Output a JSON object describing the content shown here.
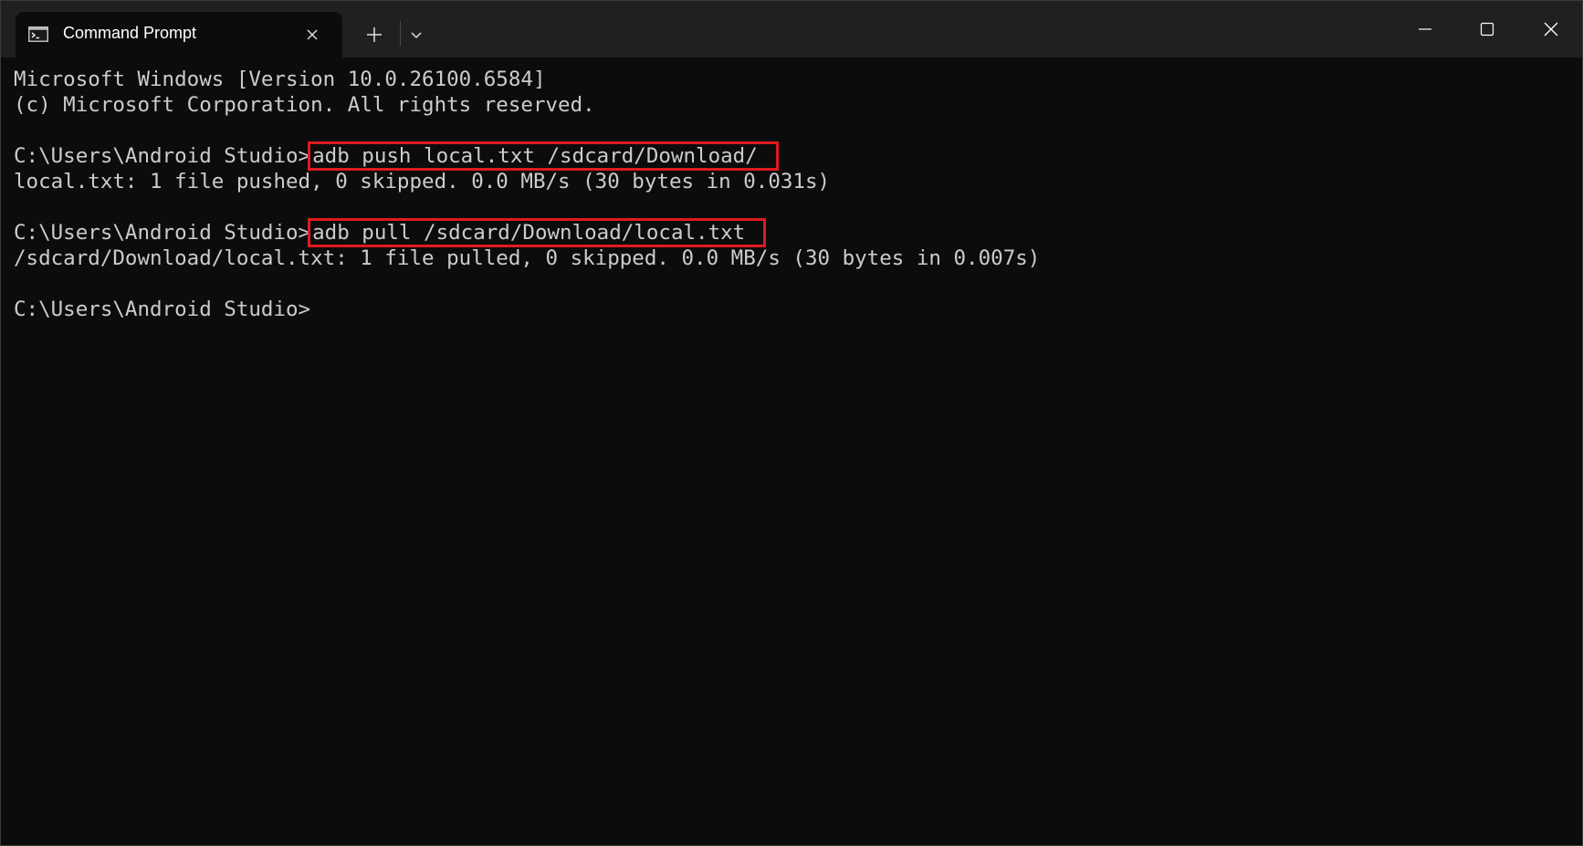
{
  "window": {
    "tab_title": "Command Prompt"
  },
  "icons": {
    "tab": "terminal-icon",
    "close_tab": "close-icon",
    "new_tab": "plus-icon",
    "dropdown": "chevron-down-icon",
    "minimize": "minimize-icon",
    "maximize": "maximize-icon",
    "close_window": "close-icon"
  },
  "colors": {
    "terminal_bg": "#0c0c0c",
    "terminal_text": "#cccccc",
    "titlebar_bg": "#202020",
    "highlight_box": "#e01a1f"
  },
  "terminal": {
    "header_line1": "Microsoft Windows [Version 10.0.26100.6584]",
    "header_line2": "(c) Microsoft Corporation. All rights reserved.",
    "prompt": "C:\\Users\\Android Studio>",
    "push_command": "adb push local.txt /sdcard/Download/",
    "push_output": "local.txt: 1 file pushed, 0 skipped. 0.0 MB/s (30 bytes in 0.031s)",
    "pull_command": "adb pull /sdcard/Download/local.txt",
    "pull_output": "/sdcard/Download/local.txt: 1 file pulled, 0 skipped. 0.0 MB/s (30 bytes in 0.007s)"
  }
}
